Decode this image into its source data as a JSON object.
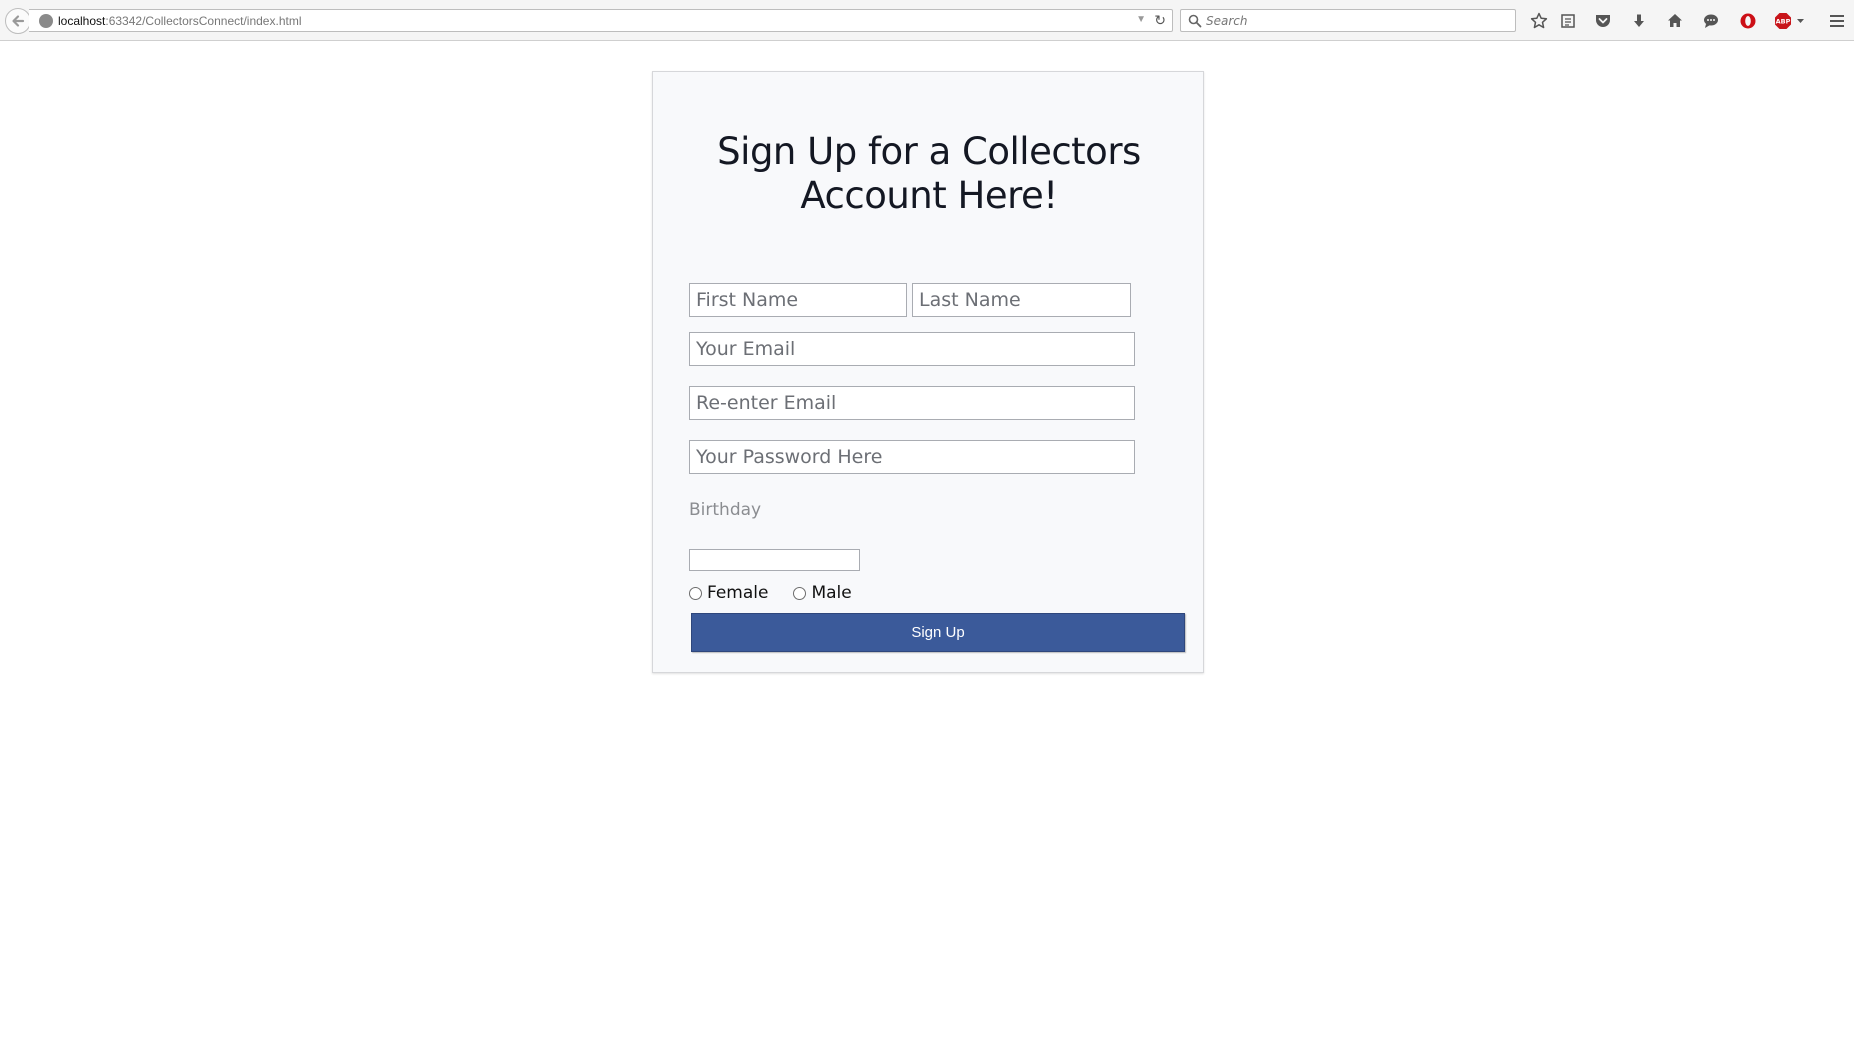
{
  "browser": {
    "url_host": "localhost",
    "url_path": ":63342/CollectorsConnect/index.html",
    "search_placeholder": "Search",
    "icons": [
      "back-arrow-icon",
      "globe-icon",
      "dropdown-arrow-icon",
      "reload-icon",
      "search-icon",
      "bookmark-star-icon",
      "reading-list-icon",
      "pocket-icon",
      "download-icon",
      "home-icon",
      "chat-icon",
      "opera-icon",
      "adblock-plus-icon",
      "menu-icon"
    ],
    "abp_label": "ABP"
  },
  "signup": {
    "title": "Sign Up for a Collectors Account Here!",
    "first_name_placeholder": "First Name",
    "last_name_placeholder": "Last Name",
    "email_placeholder": "Your Email",
    "reenter_email_placeholder": "Re-enter Email",
    "password_placeholder": "Your Password Here",
    "birthday_label": "Birthday",
    "gender_female": "Female",
    "gender_male": "Male",
    "submit_label": "Sign Up",
    "button_color": "#3b5a9a"
  }
}
